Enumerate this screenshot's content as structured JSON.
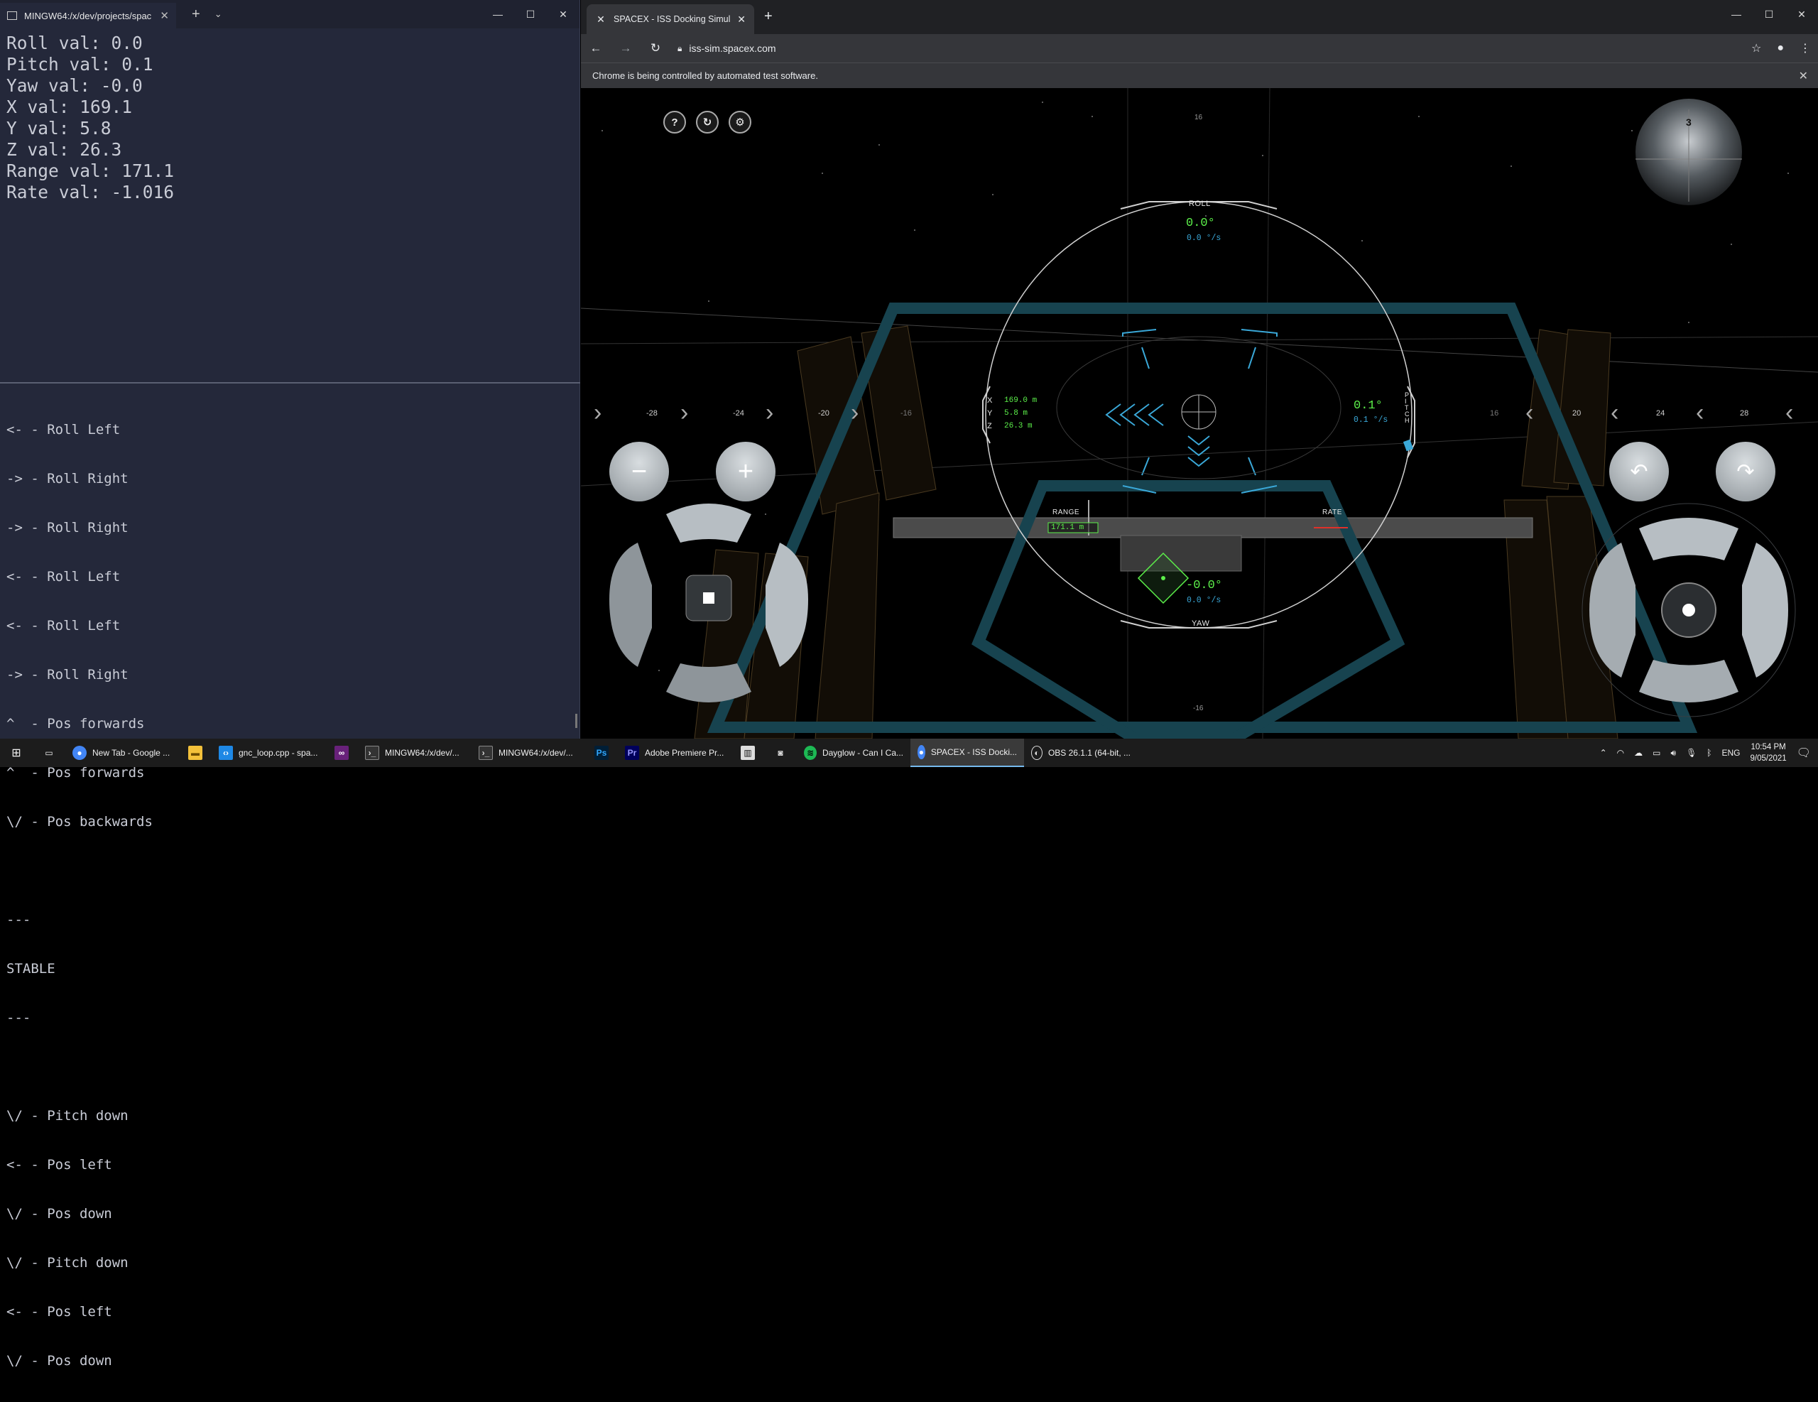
{
  "terminal": {
    "tab_title": "MINGW64:/x/dev/projects/spac",
    "telemetry": [
      "Roll val: 0.0",
      "Pitch val: 0.1",
      "Yaw val: -0.0",
      "X val: 169.1",
      "Y val: 5.8",
      "Z val: 26.3",
      "Range val: 171.1",
      "Rate val: -1.016"
    ],
    "log": [
      "<- - Roll Left",
      "-> - Roll Right",
      "-> - Roll Right",
      "<- - Roll Left",
      "<- - Roll Left",
      "-> - Roll Right",
      "^  - Pos forwards",
      "^  - Pos forwards",
      "\\/ - Pos backwards",
      "",
      "---",
      "STABLE",
      "---",
      "",
      "\\/ - Pitch down",
      "<- - Pos left",
      "\\/ - Pos down",
      "\\/ - Pitch down",
      "<- - Pos left",
      "\\/ - Pos down"
    ]
  },
  "browser": {
    "tab_title": "SPACEX - ISS Docking Simulator",
    "url": "iss-sim.spacex.com",
    "automation_notice": "Chrome is being controlled by automated test software."
  },
  "sim": {
    "help_label": "?",
    "scale_left": [
      "-28",
      "-24",
      "-20",
      "-16"
    ],
    "scale_right": [
      "16",
      "20",
      "24",
      "28"
    ],
    "top_tick": "16",
    "bottom_tick": "-16",
    "roll": {
      "label": "ROLL",
      "value": "0.0°",
      "rate": "0.0 °/s"
    },
    "pitch": {
      "label": "PITCH",
      "value": "0.1°",
      "rate": "0.1 °/s"
    },
    "yaw": {
      "label": "YAW",
      "value": "-0.0°",
      "rate": "0.0 °/s"
    },
    "position": {
      "x_label": "X",
      "x": "169.0 m",
      "y_label": "Y",
      "y": "5.8 m",
      "z_label": "Z",
      "z": "26.3 m"
    },
    "range": {
      "label": "RANGE",
      "value": "171.1 m"
    },
    "rate": {
      "label": "RATE"
    },
    "globe_number": "3",
    "colors": {
      "hud_green": "#5cf04a",
      "hud_blue": "#3aa8d8",
      "hud_line": "#d0d0d0",
      "structure_teal": "#17434f"
    }
  },
  "taskbar": {
    "items": [
      {
        "label": "New Tab - Google ...",
        "icon": "chrome-icon"
      },
      {
        "label": "",
        "icon": "file-explorer-icon"
      },
      {
        "label": "gnc_loop.cpp - spa...",
        "icon": "vscode-icon"
      },
      {
        "label": "",
        "icon": "visual-studio-icon"
      },
      {
        "label": "MINGW64:/x/dev/...",
        "icon": "terminal-icon"
      },
      {
        "label": "MINGW64:/x/dev/...",
        "icon": "terminal-icon"
      },
      {
        "label": "",
        "icon": "photoshop-icon"
      },
      {
        "label": "Adobe Premiere Pr...",
        "icon": "premiere-icon"
      },
      {
        "label": "",
        "icon": "audio-app-icon"
      },
      {
        "label": "",
        "icon": "discord-icon"
      },
      {
        "label": "Dayglow - Can I Ca...",
        "icon": "spotify-icon"
      },
      {
        "label": "SPACEX - ISS Docki...",
        "icon": "chrome-icon"
      },
      {
        "label": "OBS 26.1.1 (64-bit, ...",
        "icon": "obs-icon"
      }
    ],
    "language": "ENG",
    "time": "10:54 PM",
    "date": "9/05/2021"
  }
}
